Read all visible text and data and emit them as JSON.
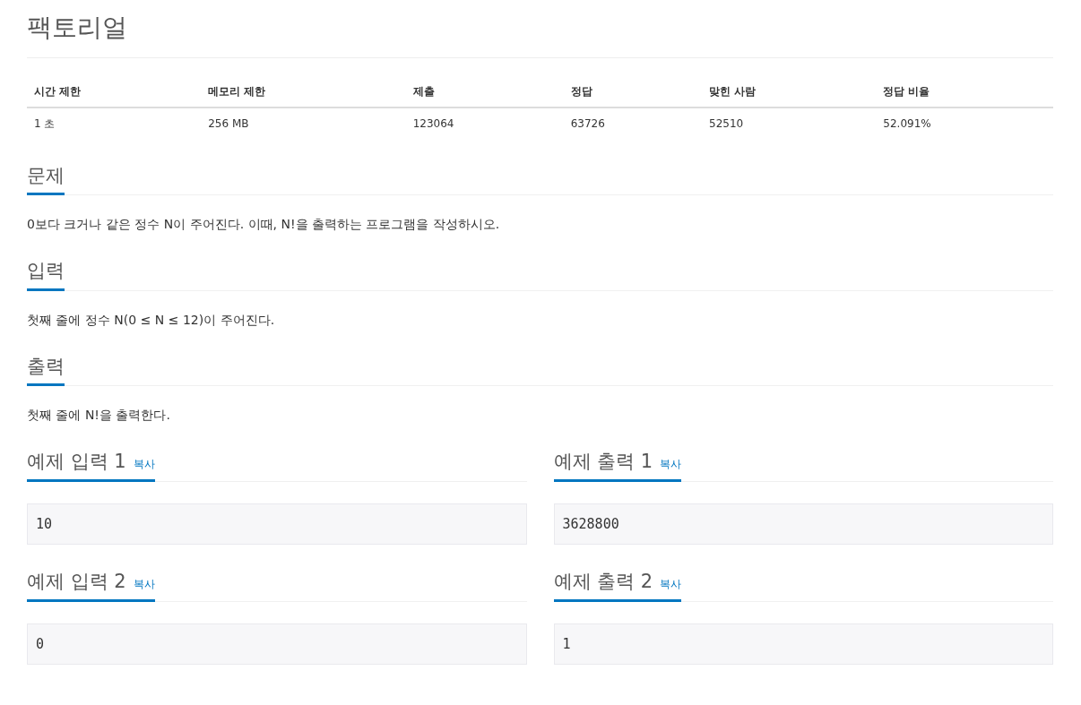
{
  "title": "팩토리얼",
  "stats": {
    "columns": [
      "시간 제한",
      "메모리 제한",
      "제출",
      "정답",
      "맞힌 사람",
      "정답 비율"
    ],
    "row": [
      "1 초",
      "256 MB",
      "123064",
      "63726",
      "52510",
      "52.091%"
    ]
  },
  "sections": [
    {
      "heading": "문제",
      "text": "0보다 크거나 같은 정수 N이 주어진다. 이때, N!을 출력하는 프로그램을 작성하시오."
    },
    {
      "heading": "입력",
      "text": "첫째 줄에 정수 N(0 ≤ N ≤ 12)이 주어진다."
    },
    {
      "heading": "출력",
      "text": "첫째 줄에 N!을 출력한다."
    }
  ],
  "samples": [
    {
      "heading": "예제 입력 1",
      "copy": "복사",
      "value": "10"
    },
    {
      "heading": "예제 출력 1",
      "copy": "복사",
      "value": "3628800"
    },
    {
      "heading": "예제 입력 2",
      "copy": "복사",
      "value": "0"
    },
    {
      "heading": "예제 출력 2",
      "copy": "복사",
      "value": "1"
    }
  ]
}
